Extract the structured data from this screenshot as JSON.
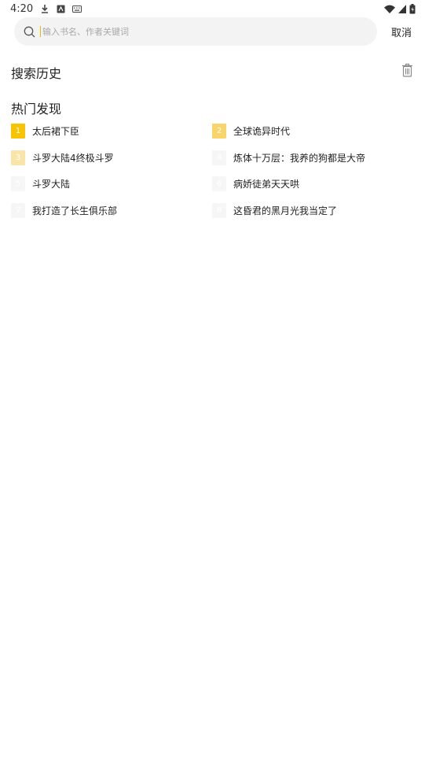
{
  "status_bar": {
    "time": "4:20"
  },
  "search": {
    "placeholder": "输入书名、作者关键词",
    "cancel_label": "取消"
  },
  "history": {
    "title": "搜索历史"
  },
  "hot": {
    "title": "热门发现",
    "items": [
      {
        "rank": "1",
        "label": "太后裙下臣",
        "badge_color": "#f8c300"
      },
      {
        "rank": "2",
        "label": "全球诡异时代",
        "badge_color": "#f9d46a"
      },
      {
        "rank": "3",
        "label": "斗罗大陆4终极斗罗",
        "badge_color": "#fbe4a7"
      },
      {
        "rank": "4",
        "label": "炼体十万层：我养的狗都是大帝",
        "badge_color": "#f6f6f6"
      },
      {
        "rank": "5",
        "label": "斗罗大陆",
        "badge_color": "#f6f6f6"
      },
      {
        "rank": "6",
        "label": "病娇徒弟天天哄",
        "badge_color": "#f6f6f6"
      },
      {
        "rank": "7",
        "label": "我打造了长生俱乐部",
        "badge_color": "#f6f6f6"
      },
      {
        "rank": "8",
        "label": "这昏君的黑月光我当定了",
        "badge_color": "#f6f6f6"
      }
    ]
  }
}
